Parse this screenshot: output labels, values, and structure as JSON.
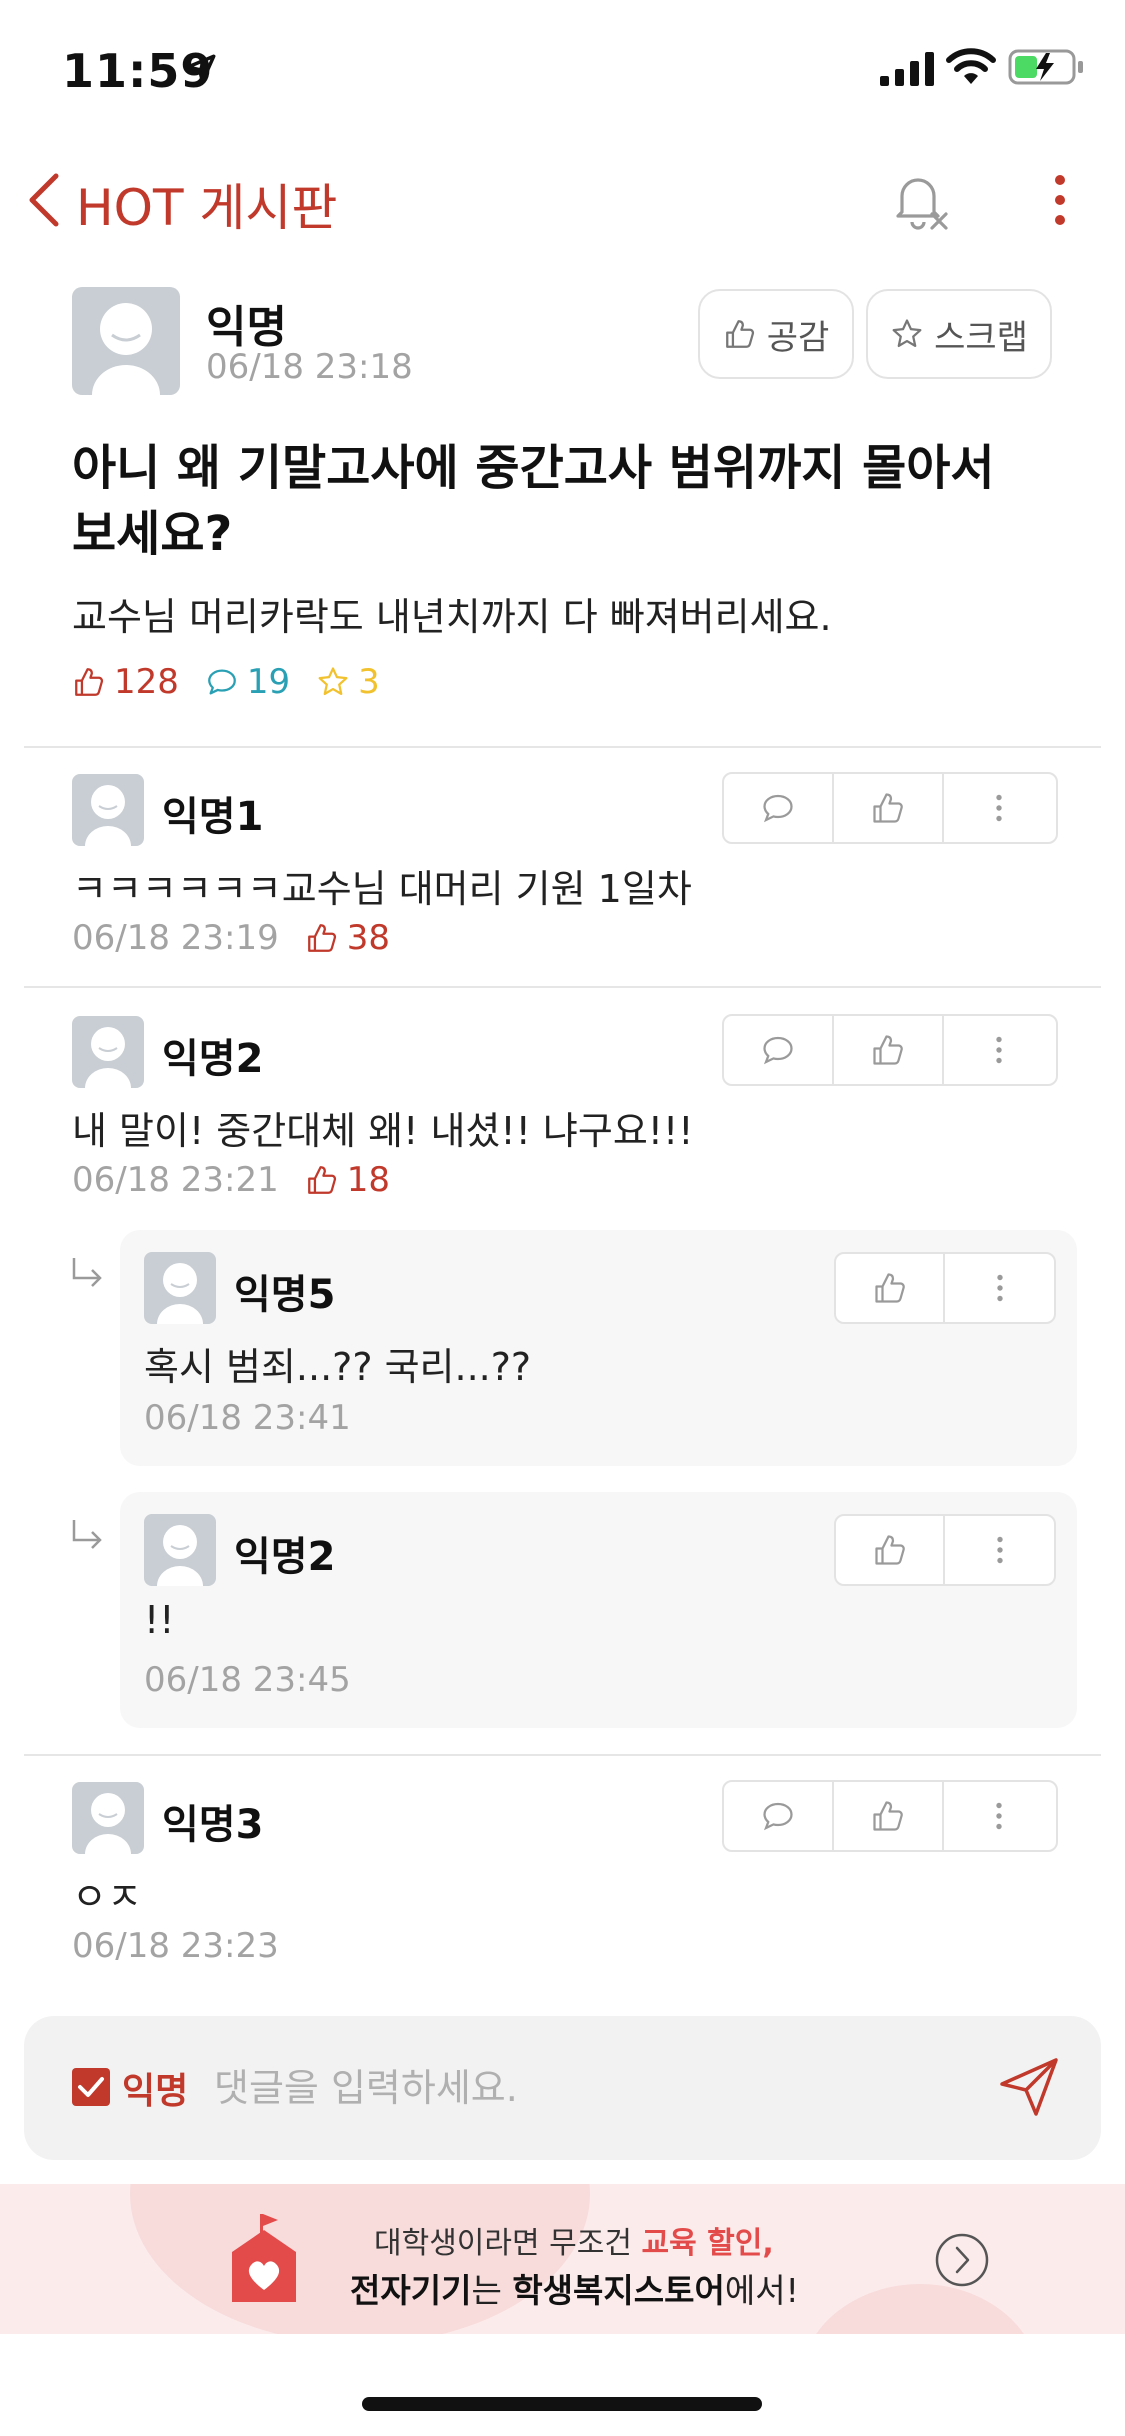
{
  "status": {
    "time": "11:59"
  },
  "nav": {
    "title": "HOT 게시판"
  },
  "post": {
    "author": "익명",
    "time": "06/18 23:18",
    "like_button_label": "공감",
    "scrap_button_label": "스크랩",
    "title": "아니 왜 기말고사에 중간고사 범위까지 몰아서 보세요?",
    "body": "교수님 머리카락도 내년치까지 다 빠져버리세요.",
    "likes": "128",
    "comments": "19",
    "scraps": "3"
  },
  "comments": [
    {
      "author": "익명1",
      "text": "ㅋㅋㅋㅋㅋㅋ교수님 대머리 기원 1일차",
      "time": "06/18 23:19",
      "likes": "38"
    },
    {
      "author": "익명2",
      "text": "내 말이! 중간대체 왜! 내셨!! 냐구요!!!",
      "time": "06/18 23:21",
      "likes": "18",
      "replies": [
        {
          "author": "익명5",
          "text": "혹시 범죄...?? 국리...??",
          "time": "06/18 23:41"
        },
        {
          "author": "익명2",
          "text": "!!",
          "time": "06/18 23:45"
        }
      ]
    },
    {
      "author": "익명3",
      "text": "ㅇㅈ",
      "time": "06/18 23:23"
    }
  ],
  "comment_input": {
    "anon_label": "익명",
    "placeholder": "댓글을 입력하세요."
  },
  "banner": {
    "line1_a": "대학생이라면 무조건 ",
    "line1_b": "교육 할인,",
    "line2_a": "전자기기",
    "line2_b": "는 ",
    "line2_c": "학생복지스토어",
    "line2_d": "에서!"
  },
  "colors": {
    "accent": "#c0392b",
    "comment_icon": "#2aa0b4",
    "scrap_icon": "#f2c12e",
    "muted": "#a3a3a3"
  },
  "icons": [
    "location-arrow-icon",
    "signal-icon",
    "wifi-icon",
    "battery-charging-icon",
    "back-chevron-icon",
    "bell-off-icon",
    "more-vertical-icon",
    "thumbs-up-icon",
    "star-icon",
    "speech-bubble-icon",
    "reply-arrow-icon",
    "send-icon",
    "chevron-right-circle-icon"
  ]
}
